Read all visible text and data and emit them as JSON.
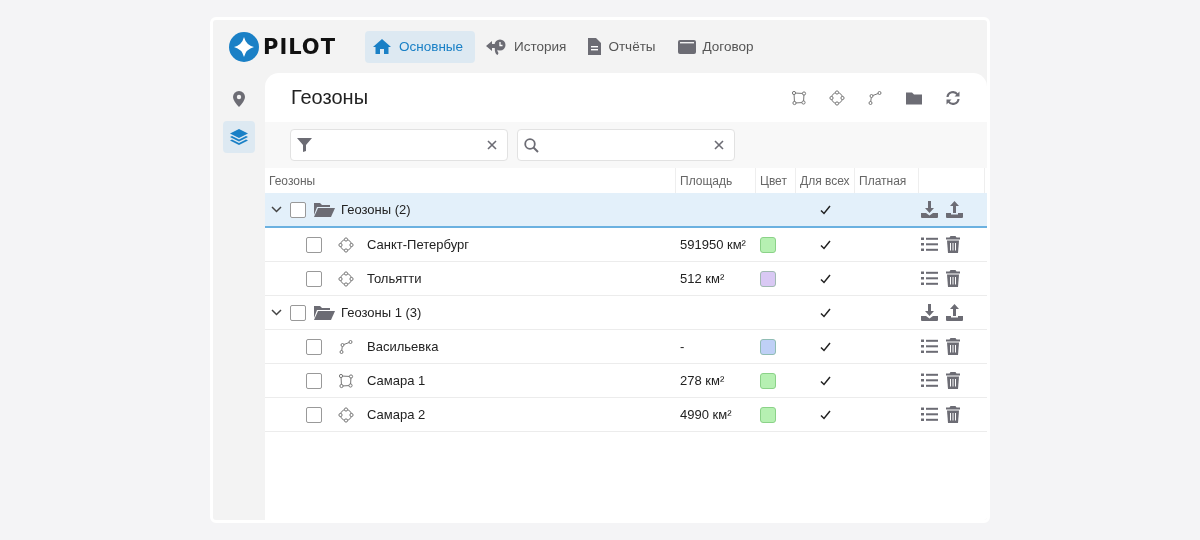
{
  "logo": {
    "text": "PILOT"
  },
  "nav": [
    {
      "label": "Основные",
      "kind": "home",
      "selected": true
    },
    {
      "label": "История",
      "kind": "history",
      "selected": false
    },
    {
      "label": "Отчёты",
      "kind": "report",
      "selected": false
    },
    {
      "label": "Договор",
      "kind": "wallet",
      "selected": false
    }
  ],
  "sidebar": [
    {
      "kind": "pin",
      "selected": false
    },
    {
      "kind": "layers",
      "selected": true
    }
  ],
  "title": "Геозоны",
  "toolbar": [
    {
      "kind": "polygon"
    },
    {
      "kind": "circle"
    },
    {
      "kind": "line"
    },
    {
      "kind": "folder"
    },
    {
      "kind": "refresh"
    }
  ],
  "filters": [
    {
      "kind": "filter"
    },
    {
      "kind": "search"
    }
  ],
  "columns": [
    "Геозоны",
    "Площадь",
    "Цвет",
    "Для всех",
    "Платная"
  ],
  "groups": [
    {
      "name": "Геозоны (2)",
      "expanded": true,
      "checked": false,
      "selected": true,
      "for_all": true,
      "children": [
        {
          "name": "Санкт-Петербург",
          "kind": "circle",
          "area": "591950 км²",
          "color": "#b6f0b2",
          "checked": false,
          "for_all": true
        },
        {
          "name": "Тольятти",
          "kind": "circle",
          "area": "512 км²",
          "color": "#d9c9f4",
          "checked": false,
          "for_all": true
        }
      ]
    },
    {
      "name": "Геозоны 1 (3)",
      "expanded": true,
      "checked": false,
      "selected": false,
      "for_all": true,
      "children": [
        {
          "name": "Васильевка",
          "kind": "line",
          "area": "-",
          "color": "#bfd0f6",
          "checked": false,
          "for_all": true
        },
        {
          "name": "Самара 1",
          "kind": "polygon",
          "area": "278 км²",
          "color": "#b6f0b2",
          "checked": false,
          "for_all": true
        },
        {
          "name": "Самара 2",
          "kind": "circle",
          "area": "4990 км²",
          "color": "#b6f0b2",
          "checked": false,
          "for_all": true
        }
      ]
    }
  ]
}
